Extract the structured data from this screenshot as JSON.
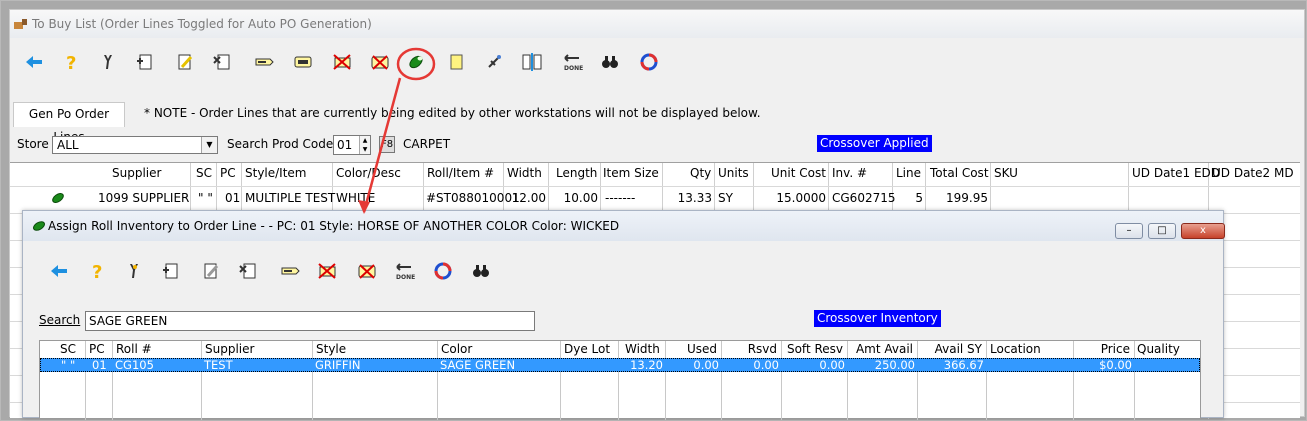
{
  "main_window": {
    "title": "To Buy List  (Order Lines Toggled for Auto PO Generation)"
  },
  "toolbar": {
    "icons": [
      "back-arrow-icon",
      "help-icon",
      "tools-icon",
      "new-document-icon",
      "edit-document-icon",
      "delete-document-icon",
      "tag-icon",
      "print-tag-icon",
      "cancel-tag-icon",
      "print-cancel-icon",
      "assign-roll-icon",
      "notes-icon",
      "link-icon",
      "split-icon",
      "done-icon",
      "find-icon",
      "refresh-icon"
    ]
  },
  "tab": {
    "label": "Gen Po Order Lines"
  },
  "note": "* NOTE - Order Lines that are currently being edited by other workstations will not be displayed below.",
  "filters": {
    "store_label": "Store",
    "store_value": "ALL",
    "search_prod_code_label": "Search Prod Code",
    "prod_code_value": "01",
    "f8_label": "F8",
    "prod_code_desc": "CARPET",
    "crossover_badge": "Crossover Applied"
  },
  "grid": {
    "headers": [
      "Supplier",
      "SC",
      "PC",
      "Style/Item",
      "Color/Desc",
      "Roll/Item #",
      "Width",
      "Length",
      "Item Size",
      "Qty",
      "Units",
      "Unit Cost",
      "Inv. #",
      "Line",
      "Total Cost",
      "SKU",
      "UD Date1 EDD",
      "UD Date2 MD"
    ],
    "row": [
      "1099 SUPPLIER",
      "\" \"",
      "01",
      "MULTIPLE TEST",
      "WHITE",
      "#ST088010001",
      "12.00",
      "10.00",
      "-------",
      "13.33",
      "SY",
      "15.0000",
      "CG602715",
      "5",
      "199.95",
      "",
      "",
      ""
    ]
  },
  "dialog": {
    "title": "Assign Roll Inventory to Order Line - -   PC: 01   Style: HORSE OF ANOTHER COLOR   Color: WICKED",
    "minimize": "–",
    "maximize": "□",
    "close": "x",
    "search_label": "Search",
    "search_value": "SAGE GREEN",
    "crossover_badge": "Crossover Inventory",
    "headers": [
      "SC",
      "PC",
      "Roll #",
      "Supplier",
      "Style",
      "Color",
      "Dye Lot",
      "Width",
      "Used",
      "Rsvd",
      "Soft Resv",
      "Amt Avail",
      "Avail SY",
      "Location",
      "Price",
      "Quality"
    ],
    "row": [
      "\" \"",
      "01",
      "CG105",
      "TEST",
      "GRIFFIN",
      "SAGE GREEN",
      "",
      "13.20",
      "0.00",
      "0.00",
      "0.00",
      "250.00",
      "366.67",
      "",
      "$0.00",
      ""
    ]
  },
  "colors": {
    "accent_blue": "#0000ff",
    "selection": "#3399ff",
    "highlight_circle": "#e53935"
  }
}
